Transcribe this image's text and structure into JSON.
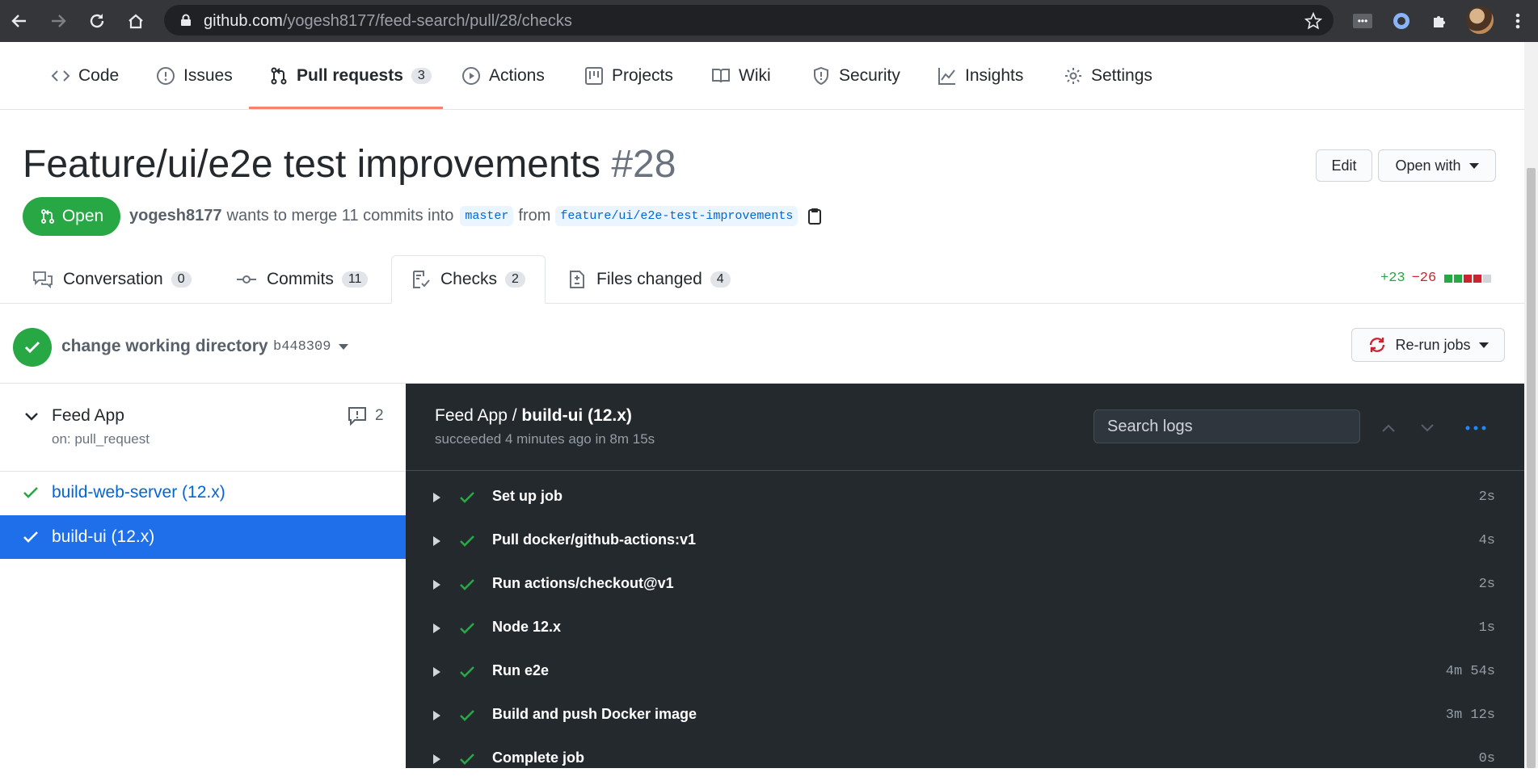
{
  "browser": {
    "url_host": "github.com",
    "url_path": "/yogesh8177/feed-search/pull/28/checks",
    "extensions": [
      "more-extension-icon",
      "circle-extension-icon",
      "puzzle-icon"
    ]
  },
  "repo_nav": {
    "tabs": [
      {
        "label": "Code",
        "icon": "code-icon"
      },
      {
        "label": "Issues",
        "icon": "issue-icon"
      },
      {
        "label": "Pull requests",
        "icon": "pull-request-icon",
        "count": "3",
        "active": true
      },
      {
        "label": "Actions",
        "icon": "play-icon"
      },
      {
        "label": "Projects",
        "icon": "project-icon"
      },
      {
        "label": "Wiki",
        "icon": "book-icon"
      },
      {
        "label": "Security",
        "icon": "shield-icon"
      },
      {
        "label": "Insights",
        "icon": "graph-icon"
      },
      {
        "label": "Settings",
        "icon": "gear-icon"
      }
    ]
  },
  "pr": {
    "title": "Feature/ui/e2e test improvements",
    "number": "#28",
    "edit_label": "Edit",
    "open_with_label": "Open with",
    "state": "Open",
    "author": "yogesh8177",
    "merge_text_1": "wants to merge 11 commits into",
    "base_branch": "master",
    "from_text": "from",
    "head_branch": "feature/ui/e2e-test-improvements"
  },
  "pr_tabs": {
    "tabs": [
      {
        "label": "Conversation",
        "count": "0"
      },
      {
        "label": "Commits",
        "count": "11"
      },
      {
        "label": "Checks",
        "count": "2"
      },
      {
        "label": "Files changed",
        "count": "4"
      }
    ],
    "additions": "+23",
    "deletions": "−26",
    "diff_blocks": [
      "#28a745",
      "#28a745",
      "#cb2431",
      "#cb2431",
      "#d1d5da"
    ]
  },
  "checks": {
    "commit_message": "change working directory",
    "commit_sha": "b448309",
    "rerun_label": "Re-run jobs"
  },
  "sidebar": {
    "workflow_name": "Feed App",
    "workflow_trigger": "on: pull_request",
    "annotations_count": "2",
    "jobs": [
      {
        "name": "build-web-server (12.x)",
        "status": "success"
      },
      {
        "name": "build-ui (12.x)",
        "status": "success",
        "selected": true
      }
    ]
  },
  "log": {
    "workflow": "Feed App / ",
    "job": "build-ui (12.x)",
    "summary": "succeeded 4 minutes ago in 8m 15s",
    "search_placeholder": "Search logs",
    "steps": [
      {
        "name": "Set up job",
        "duration": "2s"
      },
      {
        "name": "Pull docker/github-actions:v1",
        "duration": "4s"
      },
      {
        "name": "Run actions/checkout@v1",
        "duration": "2s"
      },
      {
        "name": "Node 12.x",
        "duration": "1s"
      },
      {
        "name": "Run e2e",
        "duration": "4m 54s"
      },
      {
        "name": "Build and push Docker image",
        "duration": "3m 12s"
      },
      {
        "name": "Complete job",
        "duration": "0s"
      }
    ]
  },
  "colors": {
    "success": "#28a745",
    "accent_underline": "#f9826c",
    "selected_job": "#1f6feb",
    "log_bg": "#24292e"
  }
}
